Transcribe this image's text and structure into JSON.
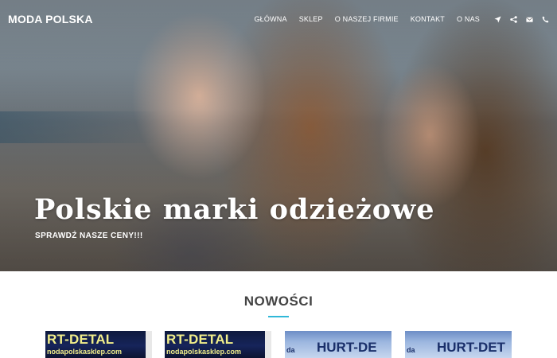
{
  "header": {
    "brand": "MODA POLSKA",
    "nav": [
      {
        "label": "GŁÓWNA"
      },
      {
        "label": "SKLEP"
      },
      {
        "label": "O NASZEJ FIRMIE"
      },
      {
        "label": "KONTAKT"
      },
      {
        "label": "O NAS"
      }
    ],
    "icons": [
      "location-arrow-icon",
      "share-icon",
      "envelope-icon",
      "phone-icon"
    ]
  },
  "hero": {
    "title": "Polskie marki odzieżowe",
    "subtitle": "SPRAWDŹ NASZE CENY!!!"
  },
  "section": {
    "title": "NOWOŚCI"
  },
  "products": [
    {
      "sign": "RT-DETAL",
      "url": "nodapolskasklep.com"
    },
    {
      "sign": "RT-DETAL",
      "url": "nodapolskasklep.com"
    },
    {
      "mark": "da",
      "sign": "HURT-DE"
    },
    {
      "mark": "da",
      "sign": "HURT-DET"
    }
  ]
}
